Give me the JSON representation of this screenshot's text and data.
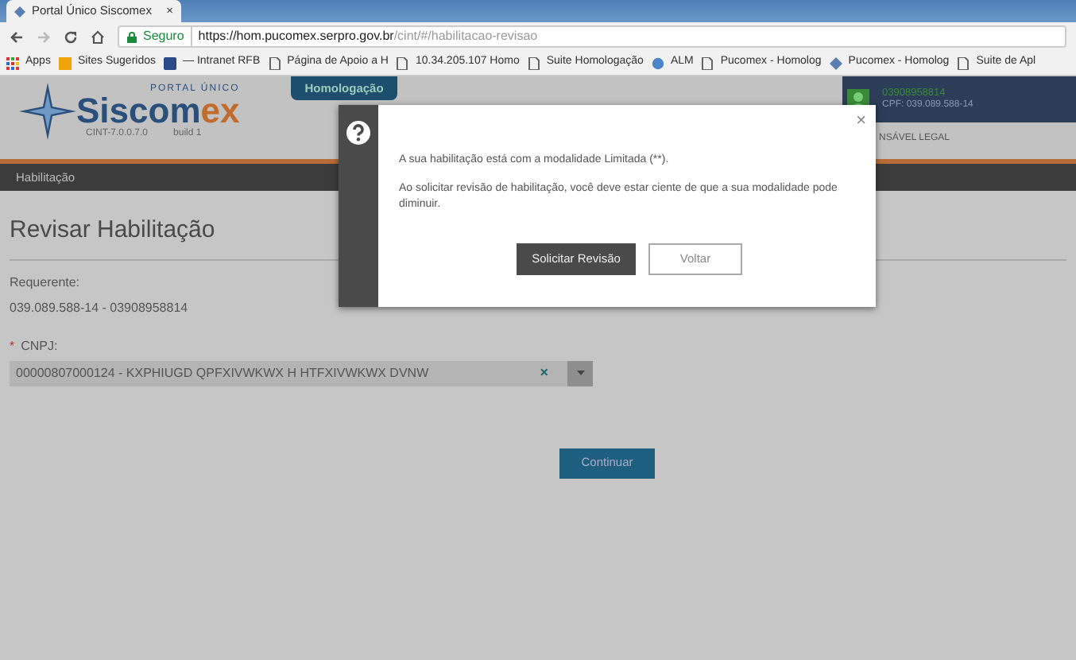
{
  "browser": {
    "tab_title": "Portal Único Siscomex",
    "close": "×",
    "secure_label": "Seguro",
    "url_host": "https://hom.pucomex.serpro.gov.br",
    "url_path": "/cint/#/habilitacao-revisao",
    "bookmarks": [
      {
        "label": "Apps",
        "kind": "apps"
      },
      {
        "label": "Sites Sugeridos",
        "kind": "bing"
      },
      {
        "label": "— Intranet RFB",
        "kind": "site"
      },
      {
        "label": "Página de Apoio a H",
        "kind": "page"
      },
      {
        "label": "10.34.205.107 Homo",
        "kind": "page"
      },
      {
        "label": "Suite Homologação",
        "kind": "page"
      },
      {
        "label": "ALM",
        "kind": "globe"
      },
      {
        "label": "Pucomex - Homolog",
        "kind": "page"
      },
      {
        "label": "Pucomex - Homolog",
        "kind": "star"
      },
      {
        "label": "Suite de Apl",
        "kind": "page"
      }
    ]
  },
  "header": {
    "logo_top": "PORTAL ÚNICO",
    "logo_main": "Siscom",
    "logo_accent": "ex",
    "version": "CINT-7.0.0.7.0",
    "build": "build 1",
    "environment": "Homologação",
    "user_id": "03908958814",
    "user_cpf": "CPF: 039.089.588-14",
    "user_role": "NSÁVEL LEGAL"
  },
  "nav": {
    "items": [
      {
        "label": "Habilitação",
        "selected": true
      }
    ]
  },
  "page": {
    "title": "Revisar Habilitação",
    "requester_label": "Requerente:",
    "requester_value": "039.089.588-14 - 03908958814",
    "cnpj_required": "*",
    "cnpj_label": "CNPJ:",
    "cnpj_value": "00000807000124 - KXPHIUGD QPFXIVWKWX H HTFXIVWKWX DVNW",
    "clear": "×",
    "continue": "Continuar"
  },
  "modal": {
    "close": "×",
    "message_1": "A sua habilitação está com a modalidade Limitada (**).",
    "message_2": "Ao solicitar revisão de habilitação, você deve estar ciente de que a sua modalidade pode diminuir.",
    "primary": "Solicitar Revisão",
    "secondary": "Voltar"
  }
}
